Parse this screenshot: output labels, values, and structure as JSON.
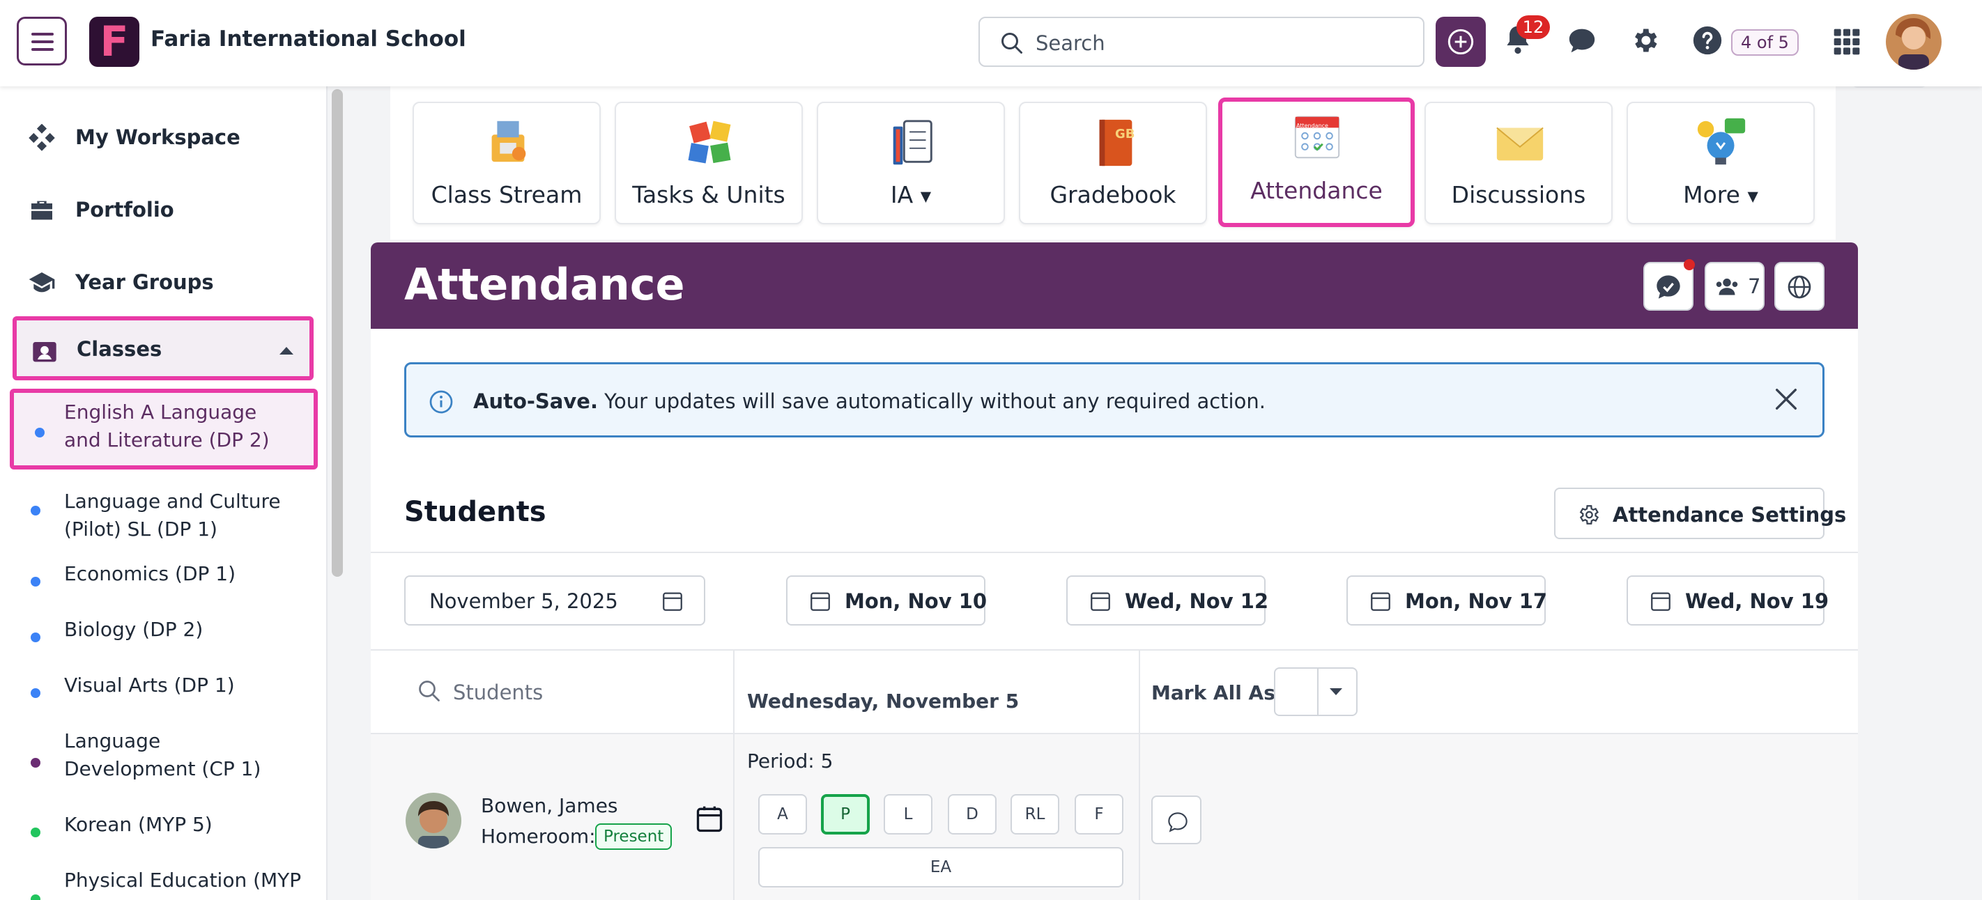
{
  "header": {
    "school_name": "Faria International School",
    "logo_letter": "F",
    "search_placeholder": "Search",
    "notification_count": "12",
    "page_counter": "4 of 5"
  },
  "sidebar": {
    "nav": [
      {
        "label": "My Workspace",
        "icon": "workspace-icon"
      },
      {
        "label": "Portfolio",
        "icon": "briefcase-icon"
      },
      {
        "label": "Year Groups",
        "icon": "graduation-cap-icon"
      }
    ],
    "classes_label": "Classes",
    "classes": [
      {
        "label": "English A Language and Literature (DP 2)",
        "dot": "#3b82f6"
      },
      {
        "label": "Language and Culture (Pilot) SL (DP 1)",
        "dot": "#3b82f6"
      },
      {
        "label": "Economics (DP 1)",
        "dot": "#3b82f6"
      },
      {
        "label": "Biology (DP 2)",
        "dot": "#3b82f6"
      },
      {
        "label": "Visual Arts (DP 1)",
        "dot": "#3b82f6"
      },
      {
        "label": "Language Development (CP 1)",
        "dot": "#6b2d73"
      },
      {
        "label": "Korean (MYP 5)",
        "dot": "#22c55e"
      },
      {
        "label": "Physical Education (MYP",
        "dot": "#22c55e"
      }
    ]
  },
  "tools": [
    {
      "label": "Class Stream"
    },
    {
      "label": "Tasks & Units"
    },
    {
      "label": "IA"
    },
    {
      "label": "Gradebook"
    },
    {
      "label": "Attendance"
    },
    {
      "label": "Discussions"
    },
    {
      "label": "More"
    }
  ],
  "gradebook_icon_text": "GB",
  "attendance_icon_text": "Attendance",
  "attendance": {
    "title": "Attendance",
    "member_count": "7",
    "autosave_bold": "Auto-Save.",
    "autosave_text": " Your updates will save automatically without any required action.",
    "students_title": "Students",
    "settings_label": "Attendance Settings",
    "date_main": "November 5, 2025",
    "dates": [
      "Mon, Nov 10",
      "Wed, Nov 12",
      "Mon, Nov 17",
      "Wed, Nov 19"
    ],
    "student_search_placeholder": "Students",
    "day_label": "Wednesday, November 5",
    "mark_all_label": "Mark All As:",
    "student": {
      "name": "Bowen, James",
      "homeroom_label": "Homeroom:",
      "homeroom_status": "Present",
      "period": "Period: 5",
      "options": [
        "A",
        "P",
        "L",
        "D",
        "RL",
        "F"
      ],
      "selected": "P",
      "extra_option": "EA"
    }
  },
  "colors": {
    "brand": "#5c2d62",
    "highlight": "#e83aa6",
    "present": "#16a34a",
    "info": "#3b82c4"
  }
}
